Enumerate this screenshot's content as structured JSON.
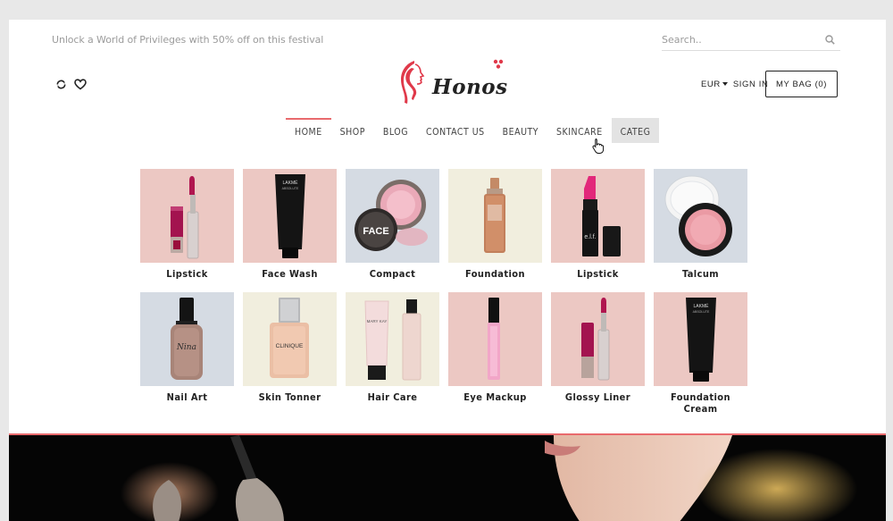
{
  "promo_text": "Unlock a World of Privileges with 50% off on this festival",
  "search": {
    "placeholder": "Search..",
    "icon": "search-icon"
  },
  "header": {
    "icons": [
      "refresh-icon",
      "heart-icon"
    ],
    "logo_text": "Honos",
    "currency": "EUR",
    "sign_in": "SIGN IN",
    "bag_label": "MY BAG (0)"
  },
  "nav": {
    "items": [
      {
        "label": "HOME"
      },
      {
        "label": "SHOP"
      },
      {
        "label": "BLOG"
      },
      {
        "label": "CONTACT US"
      },
      {
        "label": "BEAUTY"
      },
      {
        "label": "SKINCARE"
      },
      {
        "label": "CATEG"
      }
    ]
  },
  "categories": [
    {
      "label": "Lipstick"
    },
    {
      "label": "Face Wash"
    },
    {
      "label": "Compact"
    },
    {
      "label": "Foundation"
    },
    {
      "label": "Lipstick"
    },
    {
      "label": "Talcum"
    },
    {
      "label": "Nail Art"
    },
    {
      "label": "Skin Tonner"
    },
    {
      "label": "Hair Care"
    },
    {
      "label": "Eye Mackup"
    },
    {
      "label": "Glossy Liner"
    },
    {
      "label": "Foundation Cream"
    }
  ],
  "product_text": {
    "brand_lakme": "LAKMÉ",
    "face": "FACE",
    "elf": "e.l.f.",
    "nina": "Nina",
    "clinique": "CLINIQUE",
    "mary_kay": "MARY KAY",
    "lakme_sub": "ABSOLUTE"
  },
  "colors": {
    "accent": "#e96a6d",
    "pink_bg": "#ecc8c3",
    "blue_bg": "#d5dbe3",
    "cream_bg": "#f1eede"
  }
}
